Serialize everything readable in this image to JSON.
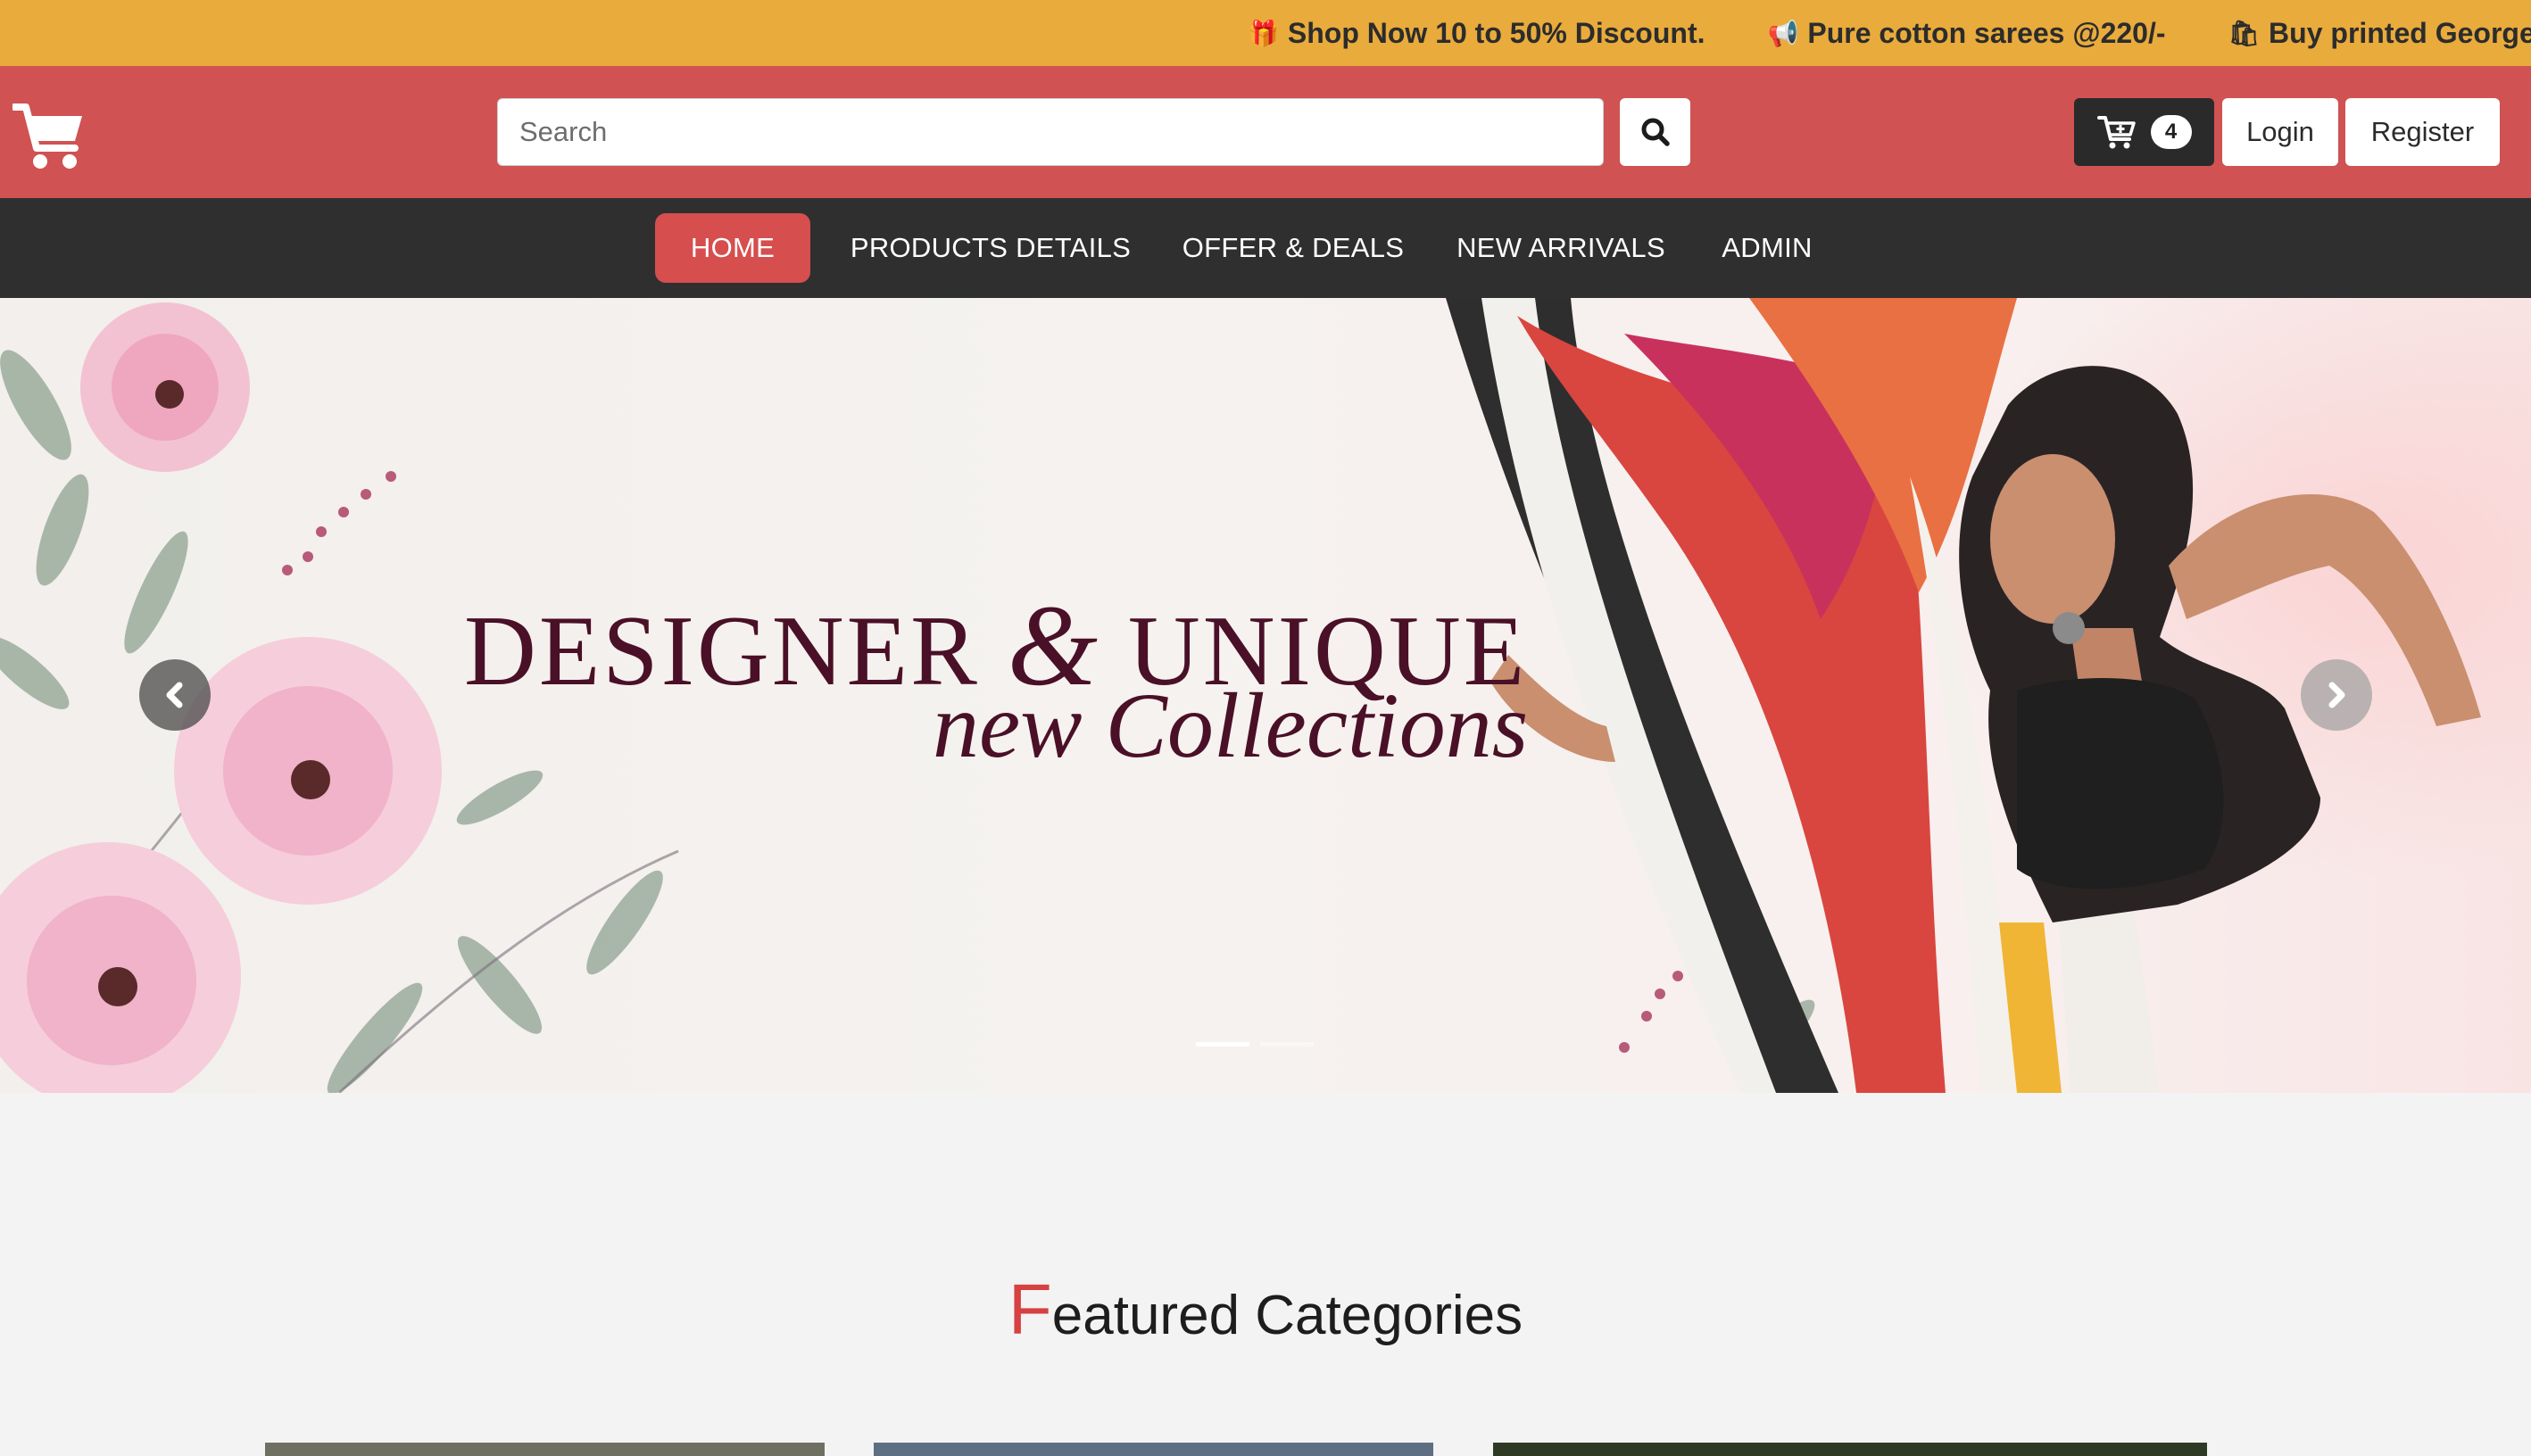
{
  "ticker": {
    "items": [
      {
        "icon": "gift-icon",
        "glyph": "🎁",
        "text": "Shop Now 10 to 50% Discount."
      },
      {
        "icon": "megaphone-icon",
        "glyph": "📢",
        "text": "Pure cotton sarees @220/-"
      },
      {
        "icon": "shopping-bag-icon",
        "glyph": "🛍",
        "text": "Buy printed George"
      }
    ]
  },
  "header": {
    "search": {
      "placeholder": "Search",
      "value": ""
    },
    "cart_count": "4",
    "login_label": "Login",
    "register_label": "Register"
  },
  "nav": {
    "items": [
      "HOME",
      "PRODUCTS DETAILS",
      "OFFER & DEALS",
      "NEW ARRIVALS",
      "ADMIN"
    ],
    "active": "HOME"
  },
  "hero": {
    "title_part1": "DESIGNER",
    "title_amp": "&",
    "title_part2": "UNIQUE",
    "subtitle": "new Collections",
    "slide_count": 2,
    "active_slide": 1
  },
  "featured": {
    "first_letter": "F",
    "rest": "eatured Categories"
  },
  "colors": {
    "ticker_bg": "#e9ab3c",
    "header_bg": "#d05252",
    "nav_bg": "#2f2f2f",
    "accent": "#d64e4e",
    "hero_text": "#4a1027"
  }
}
